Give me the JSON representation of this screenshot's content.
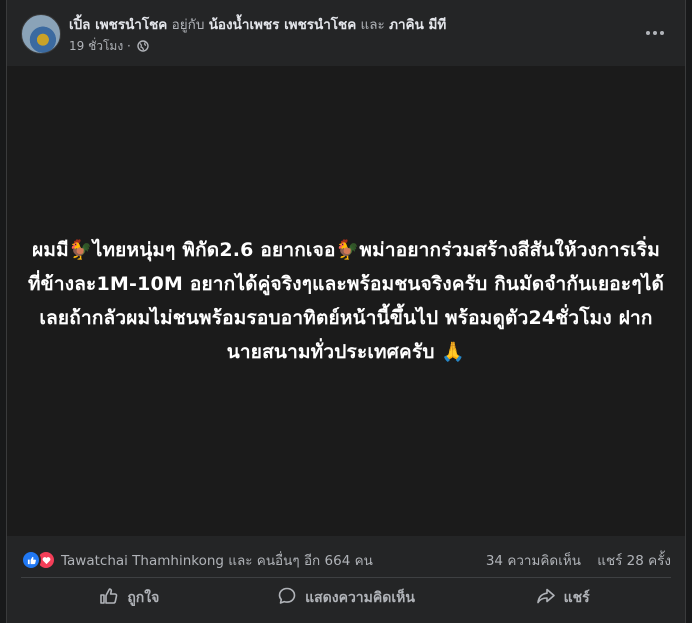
{
  "post": {
    "author": "เปิ้ล เพชรนำโชค",
    "with_text": "อยู่กับ",
    "tagged_1": "น้องน้ำเพชร เพชรนำโชค",
    "and_text": "และ",
    "tagged_2": "ภาคิน มีที",
    "time": "19 ชั่วโมง ·",
    "privacy_icon": "globe-icon",
    "body_text": "ผมมี🐓ไทยหนุ่มๆ พิกัด2.6 อยากเจอ🐓พม่าอยากร่วมสร้างสีสันให้วงการเริ่มที่ข้างละ1M-10M อยากได้คู่จริงๆและพร้อมชนจริงครับ กินมัดจำกันเยอะๆได้เลยถ้ากลัวผมไม่ชนพร้อมรอบอาทิตย์หน้านี้ขึ้นไป พร้อมดูตัว24ชั่วโมง ฝากนายสนามทั่วประเทศครับ 🙏",
    "background_color": "#1b1b1b"
  },
  "stats": {
    "reactions_text": "Tawatchai Thamhinkong และ คนอื่นๆ อีก 664 คน",
    "comments": "34 ความคิดเห็น",
    "shares": "แชร์ 28 ครั้ง"
  },
  "actions": {
    "like": "ถูกใจ",
    "comment": "แสดงความคิดเห็น",
    "share": "แชร์"
  },
  "colors": {
    "like_blue": "#2078f4",
    "love_red": "#f33e58",
    "card": "#242526"
  }
}
